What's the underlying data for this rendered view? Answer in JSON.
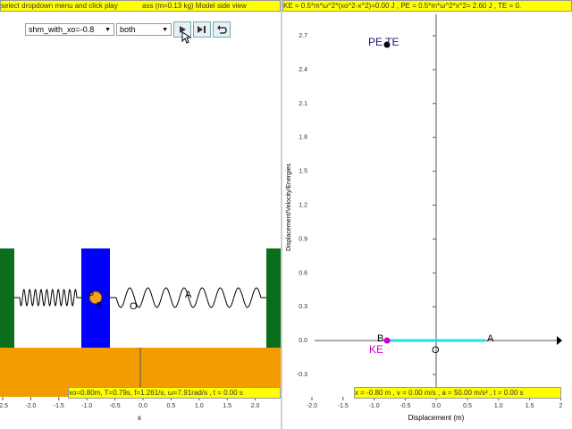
{
  "left": {
    "header": "select dropdown menu and click play",
    "header_right": "ass (m=0.13 kg) Model side view",
    "scenario_select": "shm_with_xo=-0.8",
    "mode_select": "both",
    "status": "xo=0.80m, T=0.79s, f=1.261/s, ω=7.91rad/s , t = 0.00 s",
    "axis_label": "x",
    "ticks": [
      "-2.5",
      "-2.0",
      "-1.5",
      "-1.0",
      "-0.5",
      "0.0",
      "0.5",
      "1.0",
      "1.5",
      "2.0"
    ],
    "spring_label_A": "A",
    "spring_label_O": "O",
    "mass_labels": [
      "P",
      "B"
    ]
  },
  "right": {
    "header": "KE = 0.5*m*ω^2*(xo^2-x^2)=0.00 J , PE = 0.5*m*ω^2*x^2= 2.60 J , TE = 0.",
    "status": "x = -0.80 m , v = 0.00 m/s , a = 50.00 m/s² , t = 0.00 s",
    "ylabel": "Displacement/Velocity/Energies",
    "xlabel": "Displacement (m)",
    "xticks": [
      "-2.0",
      "-1.5",
      "-1.0",
      "-0.5",
      "0.0",
      "0.5",
      "1.0",
      "1.5",
      "2"
    ],
    "yticks": [
      "2.7",
      "2.4",
      "2.1",
      "1.8",
      "1.5",
      "1.2",
      "0.9",
      "0.6",
      "0.3",
      "0.0",
      "-0.3"
    ],
    "pe_te_label": "PE TE",
    "ke_label": "KE",
    "point_B": "B",
    "point_O": "O",
    "point_A": "A"
  },
  "colors": {
    "bar": "#ffff00",
    "wall": "#0b6e1c",
    "mass": "#0000ff",
    "floor": "#f39c00",
    "path": "#22dde6",
    "ke": "#cc00cc",
    "pe": "#1a1a80"
  }
}
